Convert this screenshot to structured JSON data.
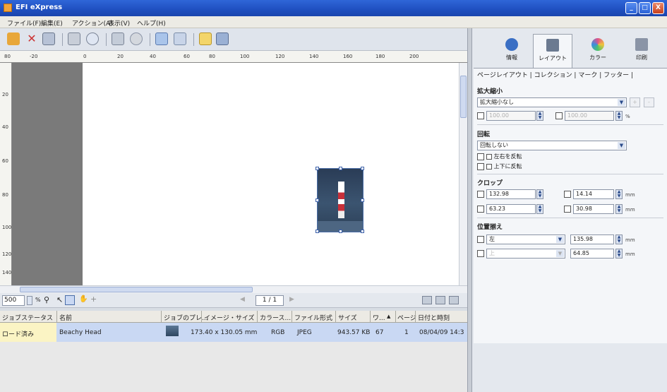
{
  "window": {
    "title": "EFI eXpress",
    "min_glyph": "_",
    "max_glyph": "□",
    "close_glyph": "X"
  },
  "menu": [
    "ファイル(F)",
    "編集(E)",
    "アクション(A)",
    "表示(V)",
    "ヘルプ(H)"
  ],
  "ruler": {
    "h_ticks": [
      "80",
      "-20",
      "0",
      "20",
      "40",
      "60",
      "80",
      "100",
      "120",
      "140",
      "160",
      "180",
      "200"
    ],
    "v_ticks": [
      "20",
      "40",
      "60",
      "80",
      "100",
      "120",
      "140"
    ]
  },
  "status": {
    "zoom_value": "500",
    "zoom_unit": "%",
    "page_indicator": "1 / 1"
  },
  "joblist": {
    "columns": [
      "ジョブステータス",
      "名前",
      "ジョブのプレ...",
      "イメージ・サイズ",
      "カラース...",
      "ファイル形式",
      "サイズ",
      "ワ...",
      "ページ",
      "日付と時刻"
    ],
    "sort_indicator": "▲",
    "rows": [
      {
        "status": "ロード済み",
        "name": "Beachy Head",
        "image_size": "173.40 x 130.05 mm",
        "color_space": "RGB",
        "format": "JPEG",
        "size": "943.57 KB",
        "w": "67",
        "pages": "1",
        "date": "08/04/09 14:3"
      }
    ]
  },
  "right_panel": {
    "tabs": [
      {
        "label": "情報",
        "icon": "info-icon",
        "color": "#3a6fc4"
      },
      {
        "label": "レイアウト",
        "icon": "layout-icon",
        "color": "#6b7a90"
      },
      {
        "label": "カラー",
        "icon": "color-icon",
        "color": "#e0528a"
      },
      {
        "label": "印刷",
        "icon": "printer-icon",
        "color": "#8a94a6"
      }
    ],
    "subtabs": "ページレイアウト | コレクション | マーク | フッター |",
    "scale": {
      "title": "拡大縮小",
      "select": "拡大縮小なし",
      "width": "100.00",
      "height": "100.00",
      "unit": "%"
    },
    "rotate": {
      "title": "回転",
      "select": "回転しない",
      "flip_h": "左右を反転",
      "flip_v": "上下に反転"
    },
    "crop": {
      "title": "クロップ",
      "left": "132.98",
      "right": "14.14",
      "top": "63.23",
      "bottom": "30.98",
      "unit": "mm"
    },
    "position": {
      "title": "位置揃え",
      "h_select": "左",
      "h_value": "135.98",
      "v_select": "上",
      "v_value": "64.85",
      "unit": "mm"
    }
  }
}
